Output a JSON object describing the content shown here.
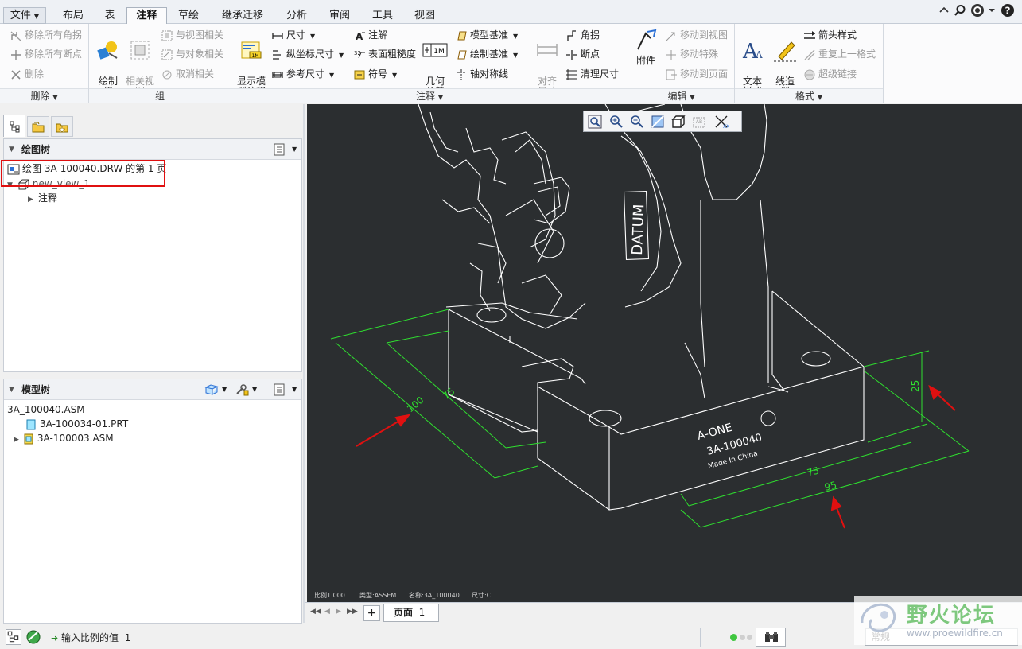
{
  "menubar": {
    "file_label": "文件",
    "tabs": [
      {
        "label": "布局"
      },
      {
        "label": "表"
      },
      {
        "label": "注释"
      },
      {
        "label": "草绘"
      },
      {
        "label": "继承迁移"
      },
      {
        "label": "分析"
      },
      {
        "label": "审阅"
      },
      {
        "label": "工具"
      },
      {
        "label": "视图"
      }
    ],
    "active_tab": "注释"
  },
  "ribbon": {
    "delete_group": {
      "items": [
        "移除所有角拐",
        "移除所有断点",
        "删除"
      ],
      "label": "删除"
    },
    "group_group": {
      "draw_group": "绘制\n组",
      "related_view": "相关视\n图",
      "items": [
        "与视图相关",
        "与对象相关",
        "取消相关"
      ],
      "label": "组"
    },
    "annotate_group": {
      "show_model_annot": "显示模\n型注释",
      "col1": [
        "尺寸",
        "纵坐标尺寸",
        "参考尺寸"
      ],
      "col2": [
        "注解",
        "表面粗糙度",
        "符号"
      ],
      "geom_tol": "几何\n公差",
      "col3": [
        "模型基准",
        "绘制基准",
        "轴对称线"
      ],
      "align_dim": "对齐\n尺寸",
      "col4": [
        "角拐",
        "断点",
        "清理尺寸"
      ],
      "label": "注释"
    },
    "edit_group": {
      "attach": "附件",
      "items": [
        "移动到视图",
        "移动特殊",
        "移动到页面"
      ],
      "label": "编辑"
    },
    "format_group": {
      "text_style": "文本\n样式",
      "line_style": "线造\n型",
      "items": [
        "箭头样式",
        "重复上一格式",
        "超级链接"
      ],
      "label": "格式"
    }
  },
  "left_panel": {
    "drawing_tree": {
      "title": "绘图树",
      "sheet": "绘图 3A-100040.DRW 的第 1 页",
      "view": "new_view_1",
      "annot": "注释"
    },
    "model_tree": {
      "title": "模型树",
      "root": "3A_100040.ASM",
      "children": [
        "3A-100034-01.PRT",
        "3A-100003.ASM"
      ]
    }
  },
  "graphics": {
    "datum_text": "DATUM",
    "brand": "A-ONE",
    "part_no": "3A-100040",
    "made_in": "Made In China",
    "dims": [
      "100",
      "75",
      "75",
      "95",
      "25"
    ],
    "info_bar": {
      "scale": "比例1.000",
      "type": "类型:ASSEM",
      "name": "名称:3A_100040",
      "size": "尺寸:C"
    },
    "colors": {
      "background": "#2b2e30",
      "model": "#ffffff",
      "dimension": "#2fe02f",
      "callout": "#e01010"
    }
  },
  "page_bar": {
    "page_label": "页面",
    "page_number": "1"
  },
  "status_bar": {
    "prompt": "输入比例的值",
    "value": "1",
    "filter": "常规"
  },
  "watermark": {
    "text": "野火论坛",
    "url": "www.proewildfire.cn"
  }
}
